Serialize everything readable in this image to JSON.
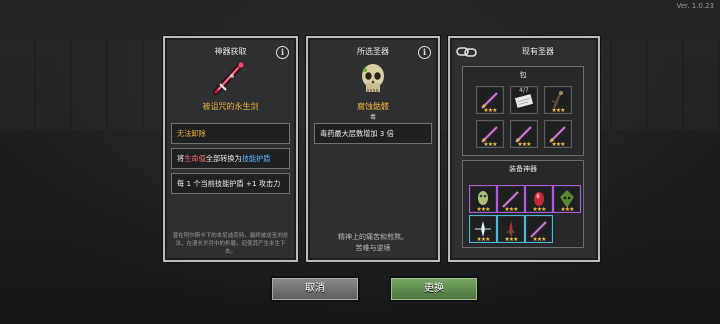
{
  "version": "Ver. 1.0.23",
  "acquire_panel": {
    "title": "神器获取",
    "item_name": "被诅咒的永生剑",
    "entries": [
      "无法卸除",
      "将生命值全部转换为技能护盾",
      "每 1 个当前技能护盾 +1 攻击力"
    ],
    "entry2_parts": [
      "将",
      "生命值",
      "全部转换为",
      "技能护盾"
    ],
    "footer_note": [
      "曾在阿尔斯卡下的本尼迪克特，最终被送至刘总",
      "法，在漫长岁月中的折磨，迫使其产生永生下去。"
    ]
  },
  "selected_panel": {
    "title": "所选圣器",
    "item_name": "腐蚀骷髅",
    "item_sub": "毒",
    "entries": [
      "毒药最大层数增加 3 倍"
    ],
    "footer_note": [
      "精神上的痛苦和煎熬。",
      "苦难与逆境"
    ]
  },
  "inventory_panel": {
    "title": "现有圣器",
    "bag_label": "包",
    "bag_counter": "4/7",
    "equip_label": "装备神器"
  },
  "buttons": {
    "cancel": "取消",
    "replace": "更换"
  },
  "colors": {
    "highlight_orange": "#f1b43a",
    "highlight_pink": "#ff6e6e",
    "highlight_blue": "#5fb7ff",
    "star": "#f3c23a",
    "cancel_bg": "#6e7072",
    "replace_bg": "#5f8a4e"
  },
  "icons": [
    "info-icon",
    "cursed-sword-icon",
    "skull-icon",
    "link-icon",
    "star-icon",
    "dagger-icon",
    "scroll-icon",
    "gem-icon",
    "crystal-icon"
  ]
}
